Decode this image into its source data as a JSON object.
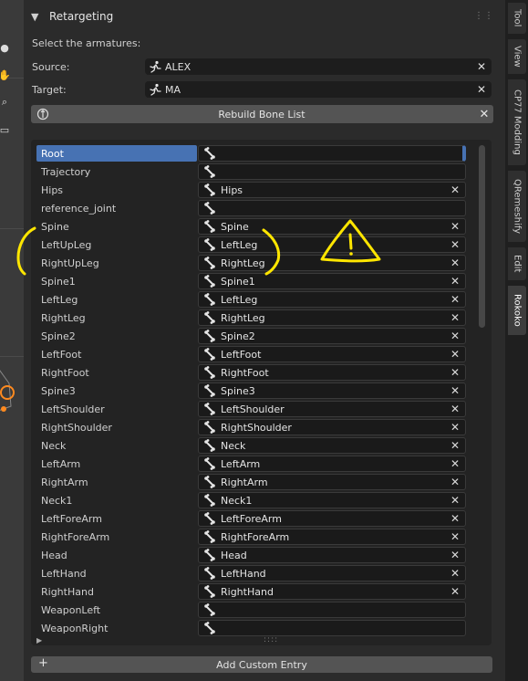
{
  "panel": {
    "header_title": "Retargeting",
    "select_label": "Select the armatures:",
    "source_label": "Source:",
    "source_value": "ALEX",
    "target_label": "Target:",
    "target_value": "MA",
    "rebuild_label": "Rebuild Bone List",
    "add_custom_label": "Add Custom Entry"
  },
  "bones": [
    {
      "source": "Root",
      "target": "",
      "selected": true
    },
    {
      "source": "Trajectory",
      "target": ""
    },
    {
      "source": "Hips",
      "target": "Hips"
    },
    {
      "source": "reference_joint",
      "target": ""
    },
    {
      "source": "Spine",
      "target": "Spine"
    },
    {
      "source": "LeftUpLeg",
      "target": "LeftLeg"
    },
    {
      "source": "RightUpLeg",
      "target": "RightLeg"
    },
    {
      "source": "Spine1",
      "target": "Spine1"
    },
    {
      "source": "LeftLeg",
      "target": "LeftLeg"
    },
    {
      "source": "RightLeg",
      "target": "RightLeg"
    },
    {
      "source": "Spine2",
      "target": "Spine2"
    },
    {
      "source": "LeftFoot",
      "target": "LeftFoot"
    },
    {
      "source": "RightFoot",
      "target": "RightFoot"
    },
    {
      "source": "Spine3",
      "target": "Spine3"
    },
    {
      "source": "LeftShoulder",
      "target": "LeftShoulder"
    },
    {
      "source": "RightShoulder",
      "target": "RightShoulder"
    },
    {
      "source": "Neck",
      "target": "Neck"
    },
    {
      "source": "LeftArm",
      "target": "LeftArm"
    },
    {
      "source": "RightArm",
      "target": "RightArm"
    },
    {
      "source": "Neck1",
      "target": "Neck1"
    },
    {
      "source": "LeftForeArm",
      "target": "LeftForeArm"
    },
    {
      "source": "RightForeArm",
      "target": "RightForeArm"
    },
    {
      "source": "Head",
      "target": "Head"
    },
    {
      "source": "LeftHand",
      "target": "LeftHand"
    },
    {
      "source": "RightHand",
      "target": "RightHand"
    },
    {
      "source": "WeaponLeft",
      "target": ""
    },
    {
      "source": "WeaponRight",
      "target": ""
    }
  ],
  "sidebar_tabs": [
    "Tool",
    "View",
    "CP77 Modding",
    "QRemeshify",
    "Edit",
    "Rokoko"
  ],
  "active_tab": "Rokoko",
  "icons": {
    "armature": "armature-icon",
    "bone": "bone-icon",
    "clear": "close-icon",
    "rebuild": "rebuild-icon",
    "add": "plus-icon",
    "expand": "triangle-right-icon"
  },
  "colors": {
    "selection": "#4772b3",
    "annotation": "#ffe600"
  }
}
